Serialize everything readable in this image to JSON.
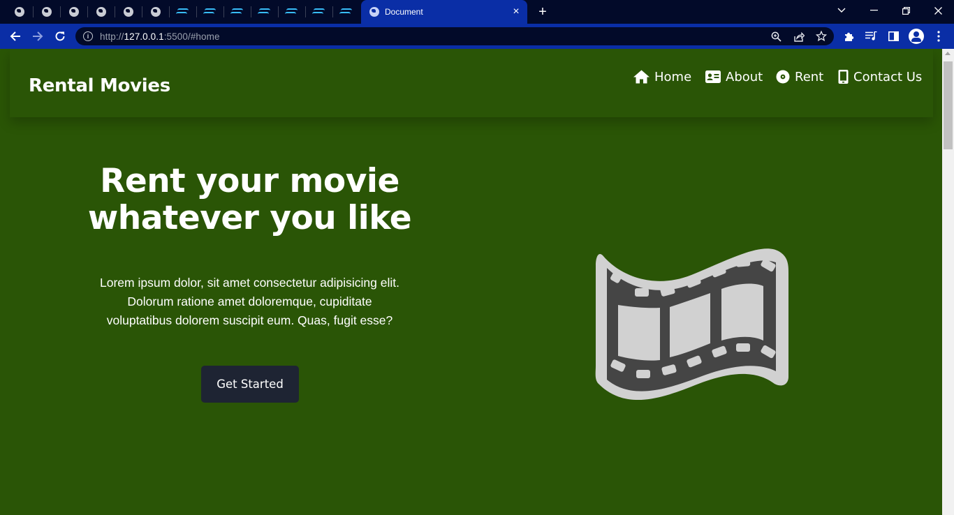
{
  "browser": {
    "pinned_tabs": [
      "globe-icon",
      "globe-icon",
      "globe-icon",
      "globe-icon",
      "globe-icon",
      "globe-icon",
      "tailwind-icon",
      "tailwind-icon",
      "tailwind-icon",
      "tailwind-icon",
      "tailwind-icon",
      "tailwind-icon",
      "tailwind-icon"
    ],
    "active_tab_title": "Document",
    "tab_close": "×",
    "new_tab": "+",
    "url_prefix": "http://",
    "url_host": "127.0.0.1",
    "url_rest": ":5500/#home",
    "accent_color": "#0a2ea6"
  },
  "page": {
    "background": "#2a5506",
    "brand": "Rental Movies",
    "nav": [
      {
        "label": "Home",
        "icon": "home-icon"
      },
      {
        "label": "About",
        "icon": "id-card-icon"
      },
      {
        "label": "Rent",
        "icon": "disc-icon"
      },
      {
        "label": "Contact Us",
        "icon": "mobile-phone-icon"
      }
    ],
    "hero": {
      "title_line1": "Rent your movie",
      "title_line2": "whatever you like",
      "text": "Lorem ipsum dolor, sit amet consectetur adipisicing elit. Dolorum ratione amet doloremque, cupiditate voluptatibus dolorem suscipit eum. Quas, fugit esse?",
      "cta": "Get Started",
      "image_icon": "film-strip-icon"
    }
  }
}
